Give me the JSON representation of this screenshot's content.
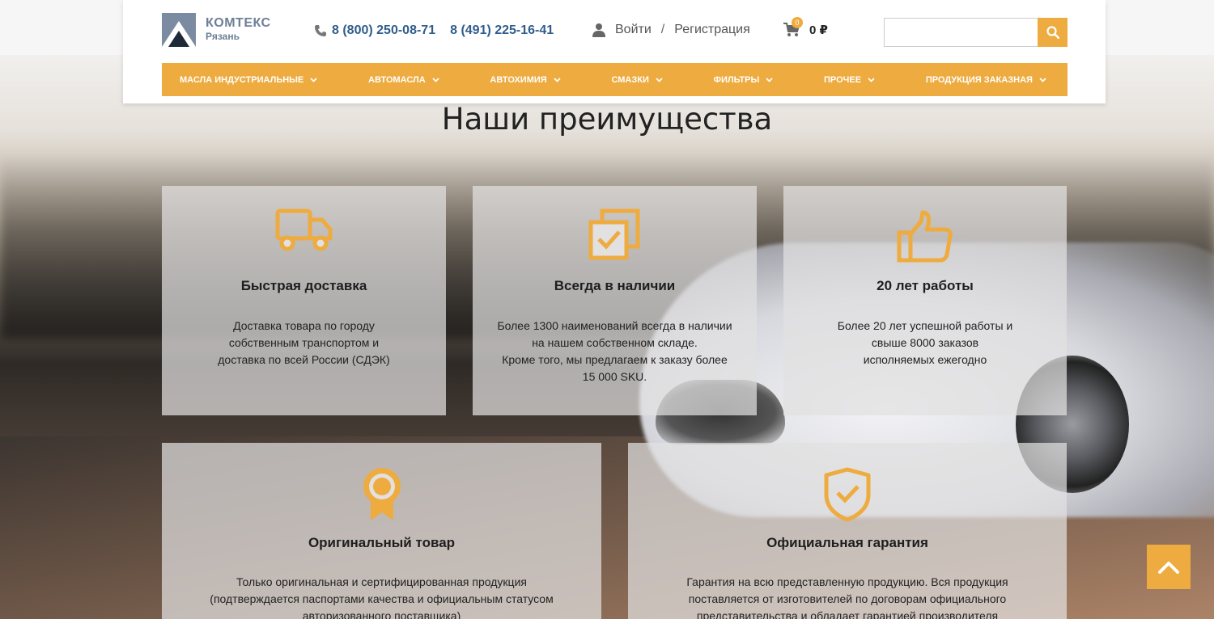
{
  "header": {
    "logo": {
      "name": "КОМТЕКС",
      "city": "Рязань"
    },
    "phones": [
      "8 (800) 250-08-71",
      "8 (491) 225-16-41"
    ],
    "auth": {
      "login": "Войти",
      "separator": "/",
      "register": "Регистрация"
    },
    "cart": {
      "count": "0",
      "sum": "0 ₽"
    },
    "search": {
      "placeholder": ""
    }
  },
  "nav": {
    "items": [
      {
        "label": "Масла индустриальные"
      },
      {
        "label": "Автомасла"
      },
      {
        "label": "Автохимия"
      },
      {
        "label": "Смазки"
      },
      {
        "label": "Фильтры"
      },
      {
        "label": "Прочее"
      },
      {
        "label": "Продукция заказная"
      }
    ]
  },
  "advantages": {
    "title": "Наши преимущества",
    "cards": [
      {
        "icon": "truck-icon",
        "title": "Быстрая доставка",
        "lines": [
          "Доставка товара по городу",
          "собственным транспортом и",
          "доставка по всей России (СДЭК)"
        ]
      },
      {
        "icon": "stock-check-icon",
        "title": "Всегда в наличии",
        "lines": [
          "Более 1300 наименований всегда в наличии",
          "на нашем собственном складе.",
          "Кроме того, мы предлагаем к заказу более",
          "15 000 SKU."
        ]
      },
      {
        "icon": "thumbs-up-icon",
        "title": "20 лет работы",
        "lines": [
          "Более 20 лет успешной работы и",
          "свыше 8000 заказов",
          "исполняемых ежегодно"
        ]
      },
      {
        "icon": "award-icon",
        "title": "Оригинальный товар",
        "lines": [
          "Только оригинальная и сертифицированная продукция",
          "(подтверждается паспортами качества и официальным статусом",
          "авторизованного поставщика)"
        ]
      },
      {
        "icon": "shield-check-icon",
        "title": "Официальная гарантия",
        "lines": [
          "Гарантия на всю представленную продукцию. Вся продукция",
          "поставляется от изготовителей по договорам официального",
          "представительства и обладает гарантией производителя"
        ]
      }
    ]
  },
  "colors": {
    "accent": "#eeab3f",
    "phone": "#2f5d8c",
    "logo": "#6d7f96"
  }
}
